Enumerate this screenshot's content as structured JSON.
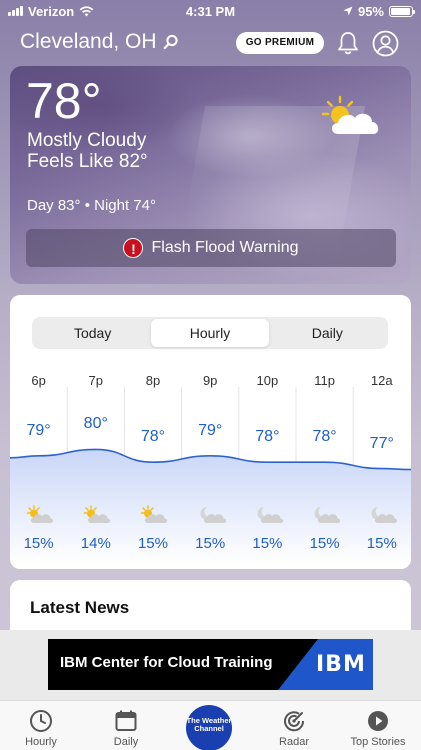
{
  "status_bar": {
    "carrier": "Verizon",
    "time": "4:31 PM",
    "battery": "95%",
    "battery_level": 0.95
  },
  "header": {
    "location": "Cleveland, OH",
    "premium_label": "GO PREMIUM"
  },
  "current": {
    "temperature": "78°",
    "condition": "Mostly Cloudy",
    "feels_like": "Feels Like 82°",
    "day_night": "Day 83° • Night 74°",
    "alert": "Flash Flood Warning"
  },
  "forecast_tabs": [
    {
      "label": "Today",
      "active": false
    },
    {
      "label": "Hourly",
      "active": true
    },
    {
      "label": "Daily",
      "active": false
    }
  ],
  "hourly": [
    {
      "time": "6p",
      "temp": "79°",
      "temp_value": 79,
      "precip": "15%",
      "icon": "partly-cloudy-icon"
    },
    {
      "time": "7p",
      "temp": "80°",
      "temp_value": 80,
      "precip": "14%",
      "icon": "partly-cloudy-icon"
    },
    {
      "time": "8p",
      "temp": "78°",
      "temp_value": 78,
      "precip": "15%",
      "icon": "partly-cloudy-icon"
    },
    {
      "time": "9p",
      "temp": "79°",
      "temp_value": 79,
      "precip": "15%",
      "icon": "cloudy-night-icon"
    },
    {
      "time": "10p",
      "temp": "78°",
      "temp_value": 78,
      "precip": "15%",
      "icon": "cloudy-night-icon"
    },
    {
      "time": "11p",
      "temp": "78°",
      "temp_value": 78,
      "precip": "15%",
      "icon": "cloudy-night-icon"
    },
    {
      "time": "12a",
      "temp": "77°",
      "temp_value": 77,
      "precip": "15%",
      "icon": "cloudy-night-icon"
    }
  ],
  "news": {
    "title": "Latest News"
  },
  "ad": {
    "text": "IBM Center for Cloud Training",
    "logo": "IBM"
  },
  "tab_bar": {
    "items": [
      {
        "label": "Hourly",
        "icon": "clock-icon"
      },
      {
        "label": "Daily",
        "icon": "calendar-icon"
      },
      {
        "label": "Radar",
        "icon": "radar-icon"
      },
      {
        "label": "Top Stories",
        "icon": "play-icon"
      }
    ],
    "center_logo": "The Weather Channel"
  },
  "colors": {
    "accent_blue": "#1f5fc8",
    "alert_red": "#c8101f",
    "brand_blue": "#1a3fb0"
  }
}
